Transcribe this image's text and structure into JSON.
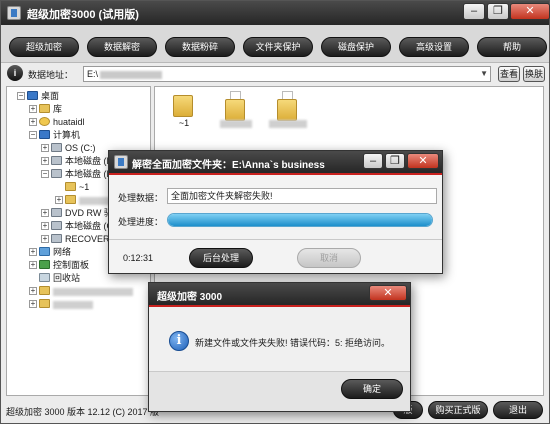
{
  "window": {
    "title": "超级加密3000 (试用版)"
  },
  "toolbar": {
    "buttons": [
      {
        "label": "超级加密"
      },
      {
        "label": "数据解密"
      },
      {
        "label": "数据粉碎"
      },
      {
        "label": "文件夹保护"
      },
      {
        "label": "磁盘保护"
      },
      {
        "label": "高级设置"
      },
      {
        "label": "帮助"
      }
    ]
  },
  "address": {
    "label": "数据地址：",
    "value": "E:\\",
    "view_label": "查看",
    "switch_label": "换肤"
  },
  "tree": {
    "items": [
      {
        "label": "桌面"
      },
      {
        "label": "库"
      },
      {
        "label": "huataidl"
      },
      {
        "label": "计算机"
      },
      {
        "label": "OS (C:)"
      },
      {
        "label": "本地磁盘 (D"
      },
      {
        "label": "本地磁盘 (E"
      },
      {
        "label": "~1"
      },
      {
        "label": "DVD RW 驱"
      },
      {
        "label": "本地磁盘 (G"
      },
      {
        "label": "RECOVERY"
      },
      {
        "label": "网络"
      },
      {
        "label": "控制面板"
      },
      {
        "label": "回收站"
      }
    ]
  },
  "files": {
    "items": [
      {
        "label": "~1"
      }
    ]
  },
  "progress_dialog": {
    "title": "解密全面加密文件夹：E:\\Anna`s business",
    "data_label": "处理数据：",
    "data_value": "全面加密文件夹解密失败!",
    "progress_label": "处理进度：",
    "progress_fraction": 1.0,
    "elapsed": "0:12:31",
    "background_label": "后台处理",
    "cancel_label": "取消"
  },
  "error_dialog": {
    "title": "超级加密 3000",
    "message": "新建文件或文件夹失败! 错误代码：5: 拒绝访问。",
    "ok_label": "确定"
  },
  "status": {
    "text": "超级加密 3000  版本 12.12  (C)  2017 版"
  },
  "bottom_buttons": {
    "register_partial": "版",
    "buy_label": "购买正式版",
    "exit_label": "退出"
  },
  "colors": {
    "title_bar": "#2e2e2e",
    "accent_red": "#c9211e",
    "progress": "#1d8fcb"
  }
}
